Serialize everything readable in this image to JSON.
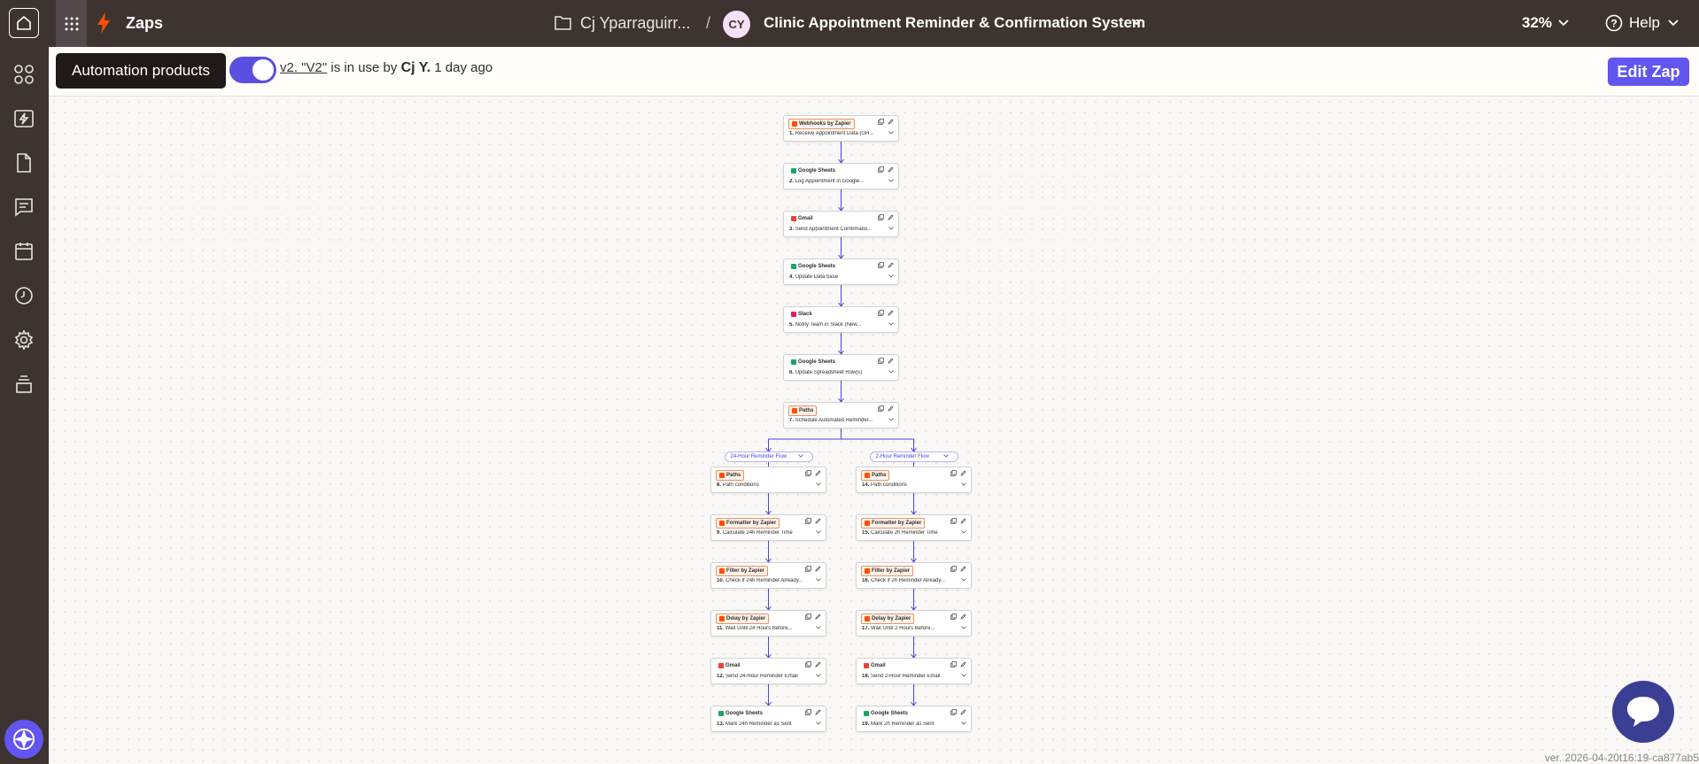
{
  "topbar": {
    "app_title": "Zaps",
    "folder_name": "Cj Yparraguirr...",
    "separator": "/",
    "avatar_initials": "CY",
    "zap_title": "Clinic Appointment Reminder & Confirmation System",
    "zoom": "32%",
    "help_label": "Help"
  },
  "sidebar": {
    "items": [
      "apps-icon",
      "zaps-icon",
      "tables-icon",
      "interfaces-icon",
      "calendar-icon",
      "history-icon",
      "settings-icon",
      "archive-icon"
    ]
  },
  "subbar": {
    "tooltip": "Automation products",
    "version_link": "v2. \"V2\"",
    "in_use_text": "is in use by",
    "user_name": "Cj Y.",
    "time_ago": "1 day ago",
    "edit_button": "Edit Zap"
  },
  "steps": [
    {
      "app": "Webhooks by Zapier",
      "title_num": "1.",
      "title": "Receive Appointment Data (GH...",
      "color": "#ff4f00"
    },
    {
      "app": "Google Sheets",
      "title_num": "2.",
      "title": "Log Appointment in Google...",
      "color": "#1fa463"
    },
    {
      "app": "Gmail",
      "title_num": "3.",
      "title": "Send Appointment Confirmatio...",
      "color": "#ea4335"
    },
    {
      "app": "Google Sheets",
      "title_num": "4.",
      "title": "Update Data base",
      "color": "#1fa463"
    },
    {
      "app": "Slack",
      "title_num": "5.",
      "title": "Notify Team in Slack (New...",
      "color": "#e01e5a"
    },
    {
      "app": "Google Sheets",
      "title_num": "6.",
      "title": "Update Spreadsheet Row(s)",
      "color": "#1fa463"
    },
    {
      "app": "Paths",
      "title_num": "7.",
      "title": "Schedule Automated Reminder...",
      "color": "#ff4f00"
    }
  ],
  "paths": [
    {
      "label": "24-Hour Reminder Flow",
      "steps": [
        {
          "app": "Paths",
          "title_num": "8.",
          "title": "Path conditions",
          "color": "#ff4f00"
        },
        {
          "app": "Formatter by Zapier",
          "title_num": "9.",
          "title": "Calculate 24h Reminder Time",
          "color": "#ff4f00"
        },
        {
          "app": "Filter by Zapier",
          "title_num": "10.",
          "title": "Check if 24h Reminder Already...",
          "color": "#ff4f00"
        },
        {
          "app": "Delay by Zapier",
          "title_num": "11.",
          "title": "Wait Until 24 Hours Before...",
          "color": "#ff4f00"
        },
        {
          "app": "Gmail",
          "title_num": "12.",
          "title": "Send 24-Hour Reminder Email",
          "color": "#ea4335"
        },
        {
          "app": "Google Sheets",
          "title_num": "13.",
          "title": "Mark 24h Reminder as Sent",
          "color": "#1fa463"
        }
      ]
    },
    {
      "label": "2-Hour Reminder Flow",
      "steps": [
        {
          "app": "Paths",
          "title_num": "14.",
          "title": "Path conditions",
          "color": "#ff4f00"
        },
        {
          "app": "Formatter by Zapier",
          "title_num": "15.",
          "title": "Calculate 2h Reminder Time",
          "color": "#ff4f00"
        },
        {
          "app": "Filter by Zapier",
          "title_num": "16.",
          "title": "Check if 2h Reminder Already...",
          "color": "#ff4f00"
        },
        {
          "app": "Delay by Zapier",
          "title_num": "17.",
          "title": "Wait Until 2 Hours Before...",
          "color": "#ff4f00"
        },
        {
          "app": "Gmail",
          "title_num": "18.",
          "title": "Send 2-Hour Reminder Email",
          "color": "#ea4335"
        },
        {
          "app": "Google Sheets",
          "title_num": "19.",
          "title": "Mark 2h Reminder as Sent",
          "color": "#1fa463"
        }
      ]
    }
  ],
  "footer": {
    "version": "ver. 2026-04-20t16:19-ca877ab5"
  },
  "colors": {
    "topbar": "#3d3330",
    "accent": "#6355f0",
    "connector": "#4b44d8",
    "chat": "#3b3f93"
  }
}
